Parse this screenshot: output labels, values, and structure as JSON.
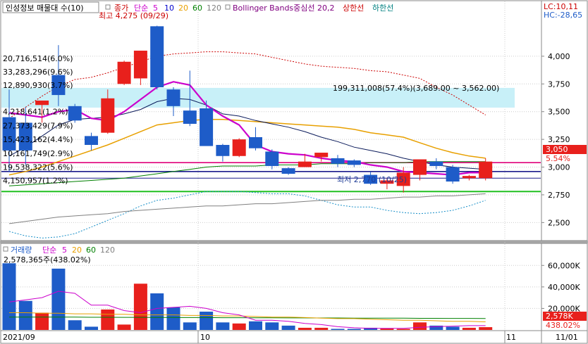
{
  "header": {
    "title": "인성정보 매물대 수(10)",
    "close_label": "종가",
    "ma_label": "단순",
    "ma_periods": [
      "5",
      "10",
      "20",
      "60",
      "120"
    ],
    "ma_colors": [
      "#cc00cc",
      "#0000cc",
      "#e8a000",
      "#008000",
      "#808080"
    ],
    "bb_label": "Bollinger Bands중심선 20,2",
    "bb_upper": "상한선",
    "bb_lower": "하한선"
  },
  "corner": {
    "lc": "LC:10,11",
    "hc": "HC:-28,65"
  },
  "volume_header": {
    "label": "거래량",
    "ma_label": "단순",
    "periods": [
      "5",
      "20",
      "60",
      "120"
    ]
  },
  "annotations": {
    "high": "최고 4,275 (09/29)",
    "low": "최저 2,770 (10/25)",
    "price_tag": "3,050",
    "pct_tag": "5.54%",
    "vol_info": "2,578,365주(438.02%)",
    "vol_tag": "2,578K",
    "vol_pct_tag": "438.02%",
    "highlight_zone": "199,311,008(57.4%)(3,689.00 ~ 3,562.00)"
  },
  "x_labels": {
    "start": "2021/09",
    "mid": "10",
    "end1": "11",
    "end2": "11/01"
  },
  "colors": {
    "up": "#e8201c",
    "down": "#1e5cc8",
    "highlight": "#c8f0f8",
    "tag_red": "#e8201c"
  },
  "chart_data": {
    "type": "candlestick",
    "price_axis": {
      "min": 2350,
      "max": 4380,
      "ticks": [
        "4,000",
        "3,750",
        "3,500",
        "3,250",
        "3,000",
        "2,750",
        "2,500"
      ],
      "tick_values": [
        4000,
        3750,
        3500,
        3250,
        3000,
        2750,
        2500
      ]
    },
    "volume_axis": {
      "min": 0,
      "max": 70000,
      "ticks": [
        "60,000K",
        "40,000K",
        "20,000K"
      ],
      "tick_values": [
        60000,
        40000,
        20000
      ]
    },
    "volume_profile": [
      {
        "label": "20,716,514(6.0%)",
        "price": 3980
      },
      {
        "label": "33,283,296(9.6%)",
        "price": 3860
      },
      {
        "label": "12,890,930(3.7%)",
        "price": 3740
      },
      {
        "label": "199,311,008(57.4%)(3,689.00 ~ 3,562.00)",
        "price": 3620
      },
      {
        "label": "4,218,641(1.2%)",
        "price": 3500
      },
      {
        "label": "27,373,429(7.9%)",
        "price": 3375
      },
      {
        "label": "15,423,162(4.4%)",
        "price": 3250
      },
      {
        "label": "10,161,749(2.9%)",
        "price": 3125
      },
      {
        "label": "19,538,322(5.6%)",
        "price": 3000
      },
      {
        "label": "4,150,957(1.2%)",
        "price": 2880
      }
    ],
    "candles": [
      {
        "o": 3450,
        "h": 3700,
        "l": 2960,
        "c": 3150
      },
      {
        "o": 3400,
        "h": 3540,
        "l": 3020,
        "c": 3150
      },
      {
        "o": 3560,
        "h": 3600,
        "l": 3400,
        "c": 3600
      },
      {
        "o": 3830,
        "h": 4100,
        "l": 3550,
        "c": 3650
      },
      {
        "o": 3550,
        "h": 3570,
        "l": 3400,
        "c": 3420
      },
      {
        "o": 3280,
        "h": 3310,
        "l": 3150,
        "c": 3200
      },
      {
        "o": 3310,
        "h": 3700,
        "l": 3300,
        "c": 3620
      },
      {
        "o": 3750,
        "h": 3960,
        "l": 3740,
        "c": 3950
      },
      {
        "o": 3800,
        "h": 4000,
        "l": 3740,
        "c": 4050
      },
      {
        "o": 4270,
        "h": 4275,
        "l": 3700,
        "c": 3720
      },
      {
        "o": 3700,
        "h": 3720,
        "l": 3460,
        "c": 3550
      },
      {
        "o": 3510,
        "h": 3870,
        "l": 3370,
        "c": 3390
      },
      {
        "o": 3530,
        "h": 3600,
        "l": 3200,
        "c": 3190
      },
      {
        "o": 3200,
        "h": 3210,
        "l": 3050,
        "c": 3100
      },
      {
        "o": 3100,
        "h": 3260,
        "l": 3090,
        "c": 3250
      },
      {
        "o": 3270,
        "h": 3360,
        "l": 3150,
        "c": 3170
      },
      {
        "o": 3140,
        "h": 3160,
        "l": 2980,
        "c": 3010
      },
      {
        "o": 2990,
        "h": 3000,
        "l": 2930,
        "c": 2940
      },
      {
        "o": 3000,
        "h": 3120,
        "l": 3000,
        "c": 3050
      },
      {
        "o": 3090,
        "h": 3100,
        "l": 3050,
        "c": 3130
      },
      {
        "o": 3080,
        "h": 3110,
        "l": 3000,
        "c": 3030
      },
      {
        "o": 3060,
        "h": 3070,
        "l": 3000,
        "c": 3020
      },
      {
        "o": 2930,
        "h": 2960,
        "l": 2840,
        "c": 2850
      },
      {
        "o": 2850,
        "h": 2900,
        "l": 2800,
        "c": 2880
      },
      {
        "o": 2830,
        "h": 3000,
        "l": 2770,
        "c": 2950
      },
      {
        "o": 2930,
        "h": 3070,
        "l": 2880,
        "c": 3070
      },
      {
        "o": 3050,
        "h": 3080,
        "l": 2980,
        "c": 3010
      },
      {
        "o": 3000,
        "h": 3020,
        "l": 2850,
        "c": 2870
      },
      {
        "o": 2900,
        "h": 2930,
        "l": 2880,
        "c": 2920
      },
      {
        "o": 2900,
        "h": 3080,
        "l": 2880,
        "c": 3050
      }
    ],
    "volumes": [
      62000,
      27000,
      16000,
      57000,
      9000,
      3000,
      19000,
      5000,
      43000,
      34000,
      21000,
      7000,
      17000,
      7000,
      6000,
      8000,
      7000,
      4000,
      2000,
      2000,
      1000,
      1000,
      2000,
      1500,
      1000,
      7000,
      4000,
      3000,
      2000,
      2578
    ],
    "ma5": [
      3490,
      3470,
      3450,
      3500,
      3520,
      3440,
      3420,
      3500,
      3610,
      3720,
      3770,
      3740,
      3560,
      3460,
      3380,
      3200,
      3140,
      3120,
      3110,
      3080,
      3060,
      3050,
      3020,
      3000,
      2960,
      2950,
      2940,
      2930,
      2950,
      2950
    ],
    "ma10": [
      3100,
      3180,
      3280,
      3380,
      3430,
      3440,
      3450,
      3480,
      3520,
      3590,
      3620,
      3610,
      3560,
      3480,
      3460,
      3420,
      3390,
      3360,
      3320,
      3270,
      3230,
      3180,
      3150,
      3120,
      3080,
      3050,
      3020,
      3000,
      2990,
      2980
    ],
    "ma20": [
      2930,
      2960,
      3000,
      3050,
      3100,
      3150,
      3200,
      3260,
      3320,
      3380,
      3400,
      3420,
      3430,
      3430,
      3420,
      3410,
      3400,
      3390,
      3380,
      3370,
      3360,
      3340,
      3310,
      3290,
      3270,
      3220,
      3170,
      3130,
      3100,
      3080
    ],
    "ma60": [
      2830,
      2840,
      2850,
      2860,
      2870,
      2880,
      2890,
      2900,
      2920,
      2940,
      2960,
      2980,
      3000,
      3010,
      3010,
      3010,
      3020,
      3020,
      3020,
      3030,
      3030,
      3030,
      3040,
      3040,
      3040,
      3050,
      3050,
      3050,
      3050,
      3050
    ],
    "ma120": [
      2490,
      2510,
      2530,
      2550,
      2560,
      2570,
      2580,
      2600,
      2610,
      2620,
      2630,
      2640,
      2650,
      2650,
      2660,
      2670,
      2670,
      2680,
      2690,
      2700,
      2700,
      2710,
      2710,
      2720,
      2730,
      2730,
      2740,
      2740,
      2750,
      2760
    ],
    "bb_upper": [
      3440,
      3540,
      3640,
      3730,
      3790,
      3810,
      3850,
      3900,
      3950,
      4000,
      4020,
      4030,
      4040,
      4040,
      4030,
      4020,
      3990,
      3960,
      3930,
      3910,
      3900,
      3890,
      3870,
      3860,
      3830,
      3800,
      3720,
      3650,
      3560,
      3470
    ],
    "bb_lower": [
      2420,
      2380,
      2360,
      2370,
      2400,
      2460,
      2520,
      2580,
      2650,
      2700,
      2720,
      2750,
      2780,
      2780,
      2780,
      2770,
      2760,
      2760,
      2740,
      2700,
      2660,
      2640,
      2640,
      2610,
      2590,
      2580,
      2590,
      2610,
      2650,
      2700
    ],
    "vol_ma5": [
      26000,
      28000,
      30000,
      36000,
      34000,
      23000,
      23000,
      18000,
      16000,
      20000,
      21000,
      22000,
      20000,
      16000,
      14000,
      9000,
      9000,
      8000,
      6000,
      5000,
      3000,
      2000,
      1500,
      1500,
      1500,
      2500,
      3000,
      3500,
      4000,
      4000
    ],
    "vol_ma20": [
      16000,
      16000,
      15500,
      15500,
      15000,
      15000,
      14500,
      14500,
      14000,
      14000,
      14000,
      13500,
      13500,
      13000,
      13000,
      12500,
      12000,
      12000,
      11500,
      11000,
      10500,
      10500,
      10000,
      9500,
      9000,
      9000,
      8500,
      8000,
      8000,
      7500
    ],
    "vol_ma60": [
      12000,
      12000,
      12000,
      11900,
      11900,
      11800,
      11800,
      11700,
      11700,
      11600,
      11600,
      11500,
      11500,
      11400,
      11400,
      11300,
      11300,
      11200,
      11200,
      11100,
      11100,
      11000,
      11000,
      10900,
      10900,
      10800,
      10800,
      10700,
      10700,
      10600
    ]
  }
}
